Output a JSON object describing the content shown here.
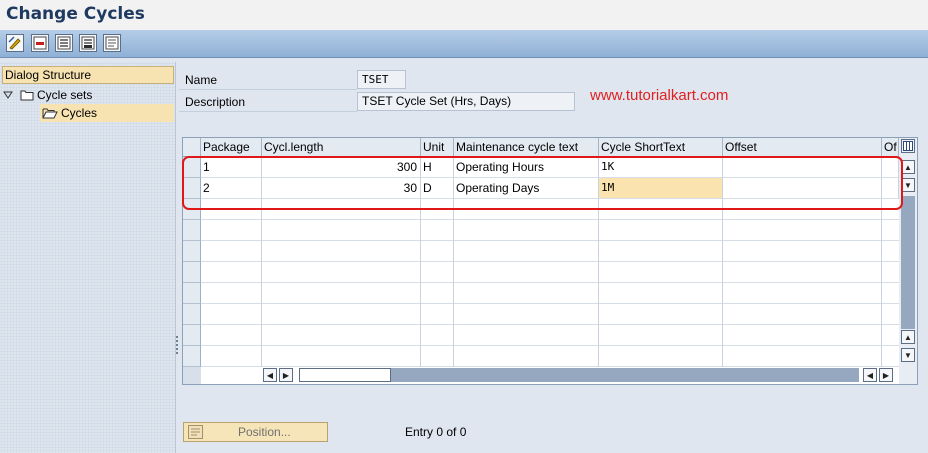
{
  "title": "Change Cycles",
  "toolbar": {
    "buttons": [
      "display-change-icon",
      "delete-icon",
      "select-all-icon",
      "select-block-icon",
      "deselect-all-icon"
    ]
  },
  "dialog_structure": {
    "header": "Dialog Structure",
    "items": [
      {
        "label": "Cycle sets",
        "icon": "folder-icon",
        "expanded": true
      },
      {
        "label": "Cycles",
        "icon": "open-folder-icon",
        "selected": true
      }
    ]
  },
  "fields": {
    "name_label": "Name",
    "name_value": "TSET",
    "description_label": "Description",
    "description_value": "TSET Cycle Set (Hrs, Days)"
  },
  "watermark": "www.tutorialkart.com",
  "table": {
    "columns": [
      "Package",
      "Cycl.length",
      "Unit",
      "Maintenance cycle text",
      "Cycle ShortText",
      "Offset",
      "Of"
    ],
    "rows": [
      {
        "package": "1",
        "length": "300",
        "unit": "H",
        "text": "Operating Hours",
        "short": "1K",
        "offset": ""
      },
      {
        "package": "2",
        "length": "30",
        "unit": "D",
        "text": "Operating Days",
        "short": "1M",
        "offset": ""
      }
    ]
  },
  "position_button": "Position...",
  "entry_text": "Entry 0 of 0",
  "colors": {
    "accent_selected": "#f7e3b1",
    "title": "#1f3a60",
    "highlight": "#e01818",
    "watermark": "#e02020"
  }
}
